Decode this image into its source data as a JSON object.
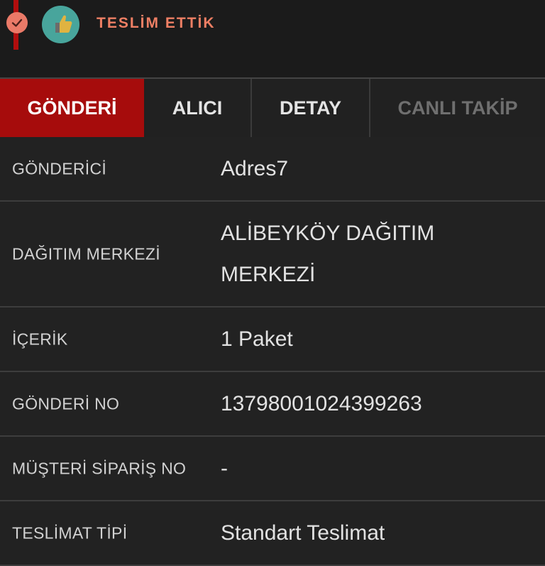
{
  "header": {
    "status_text": "TESLİM ETTİK",
    "status_icon": "check-icon",
    "avatar_icon": "thumbs-up-icon",
    "colors": {
      "status": "#ee7f64",
      "timeline": "#b10e0e",
      "avatar_bg": "#48a59c"
    }
  },
  "tabs": [
    {
      "label": "GÖNDERİ",
      "active": true
    },
    {
      "label": "ALICI",
      "active": false
    },
    {
      "label": "DETAY",
      "active": false
    },
    {
      "label": "CANLI TAKİP",
      "active": false,
      "disabled": true
    }
  ],
  "details": [
    {
      "label": "GÖNDERİCİ",
      "value": "Adres7"
    },
    {
      "label": "DAĞITIM MERKEZİ",
      "value": "ALİBEYKÖY DAĞITIM MERKEZİ"
    },
    {
      "label": "İÇERİK",
      "value": "1 Paket"
    },
    {
      "label": "GÖNDERİ NO",
      "value": "13798001024399263"
    },
    {
      "label": "MÜŞTERİ SİPARİŞ NO",
      "value": "-"
    },
    {
      "label": "TESLİMAT TİPİ",
      "value": "Standart Teslimat"
    }
  ],
  "theme": {
    "accent": "#a60c0c",
    "background": "#222222"
  }
}
